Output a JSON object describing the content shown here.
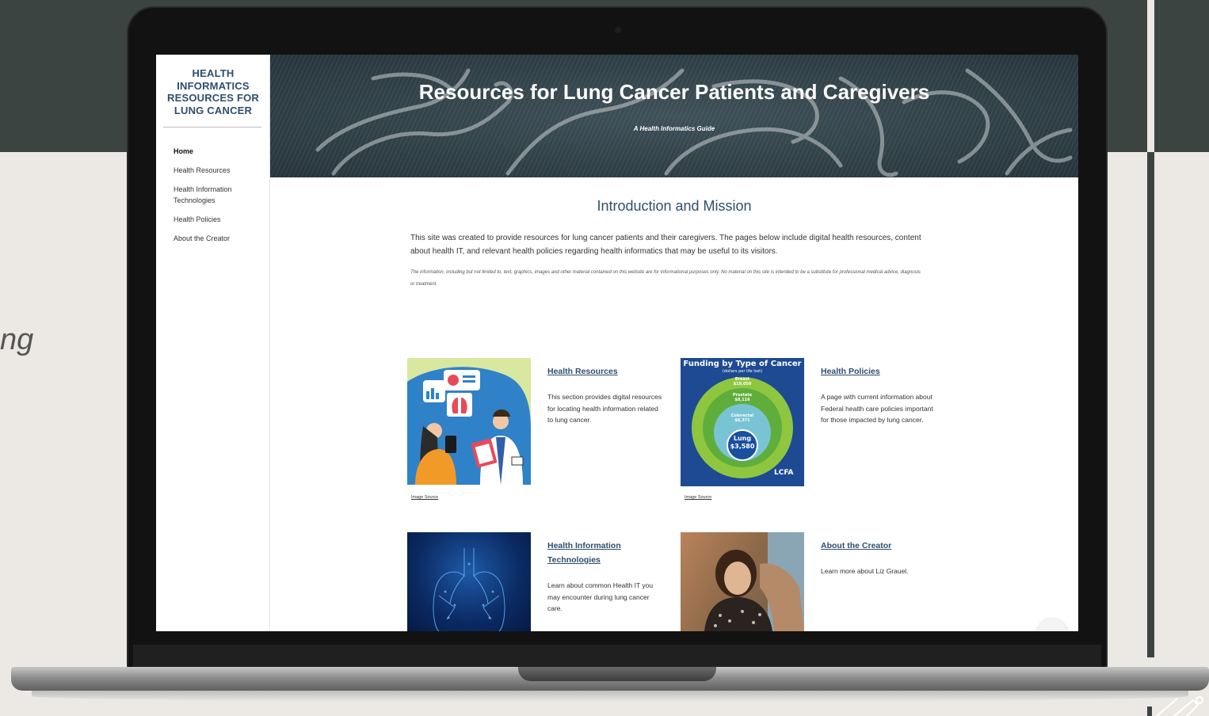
{
  "backdrop": {
    "stray_text": "ng"
  },
  "site": {
    "title": "HEALTH INFORMATICS RESOURCES FOR LUNG CANCER",
    "nav": [
      {
        "label": "Home",
        "active": true
      },
      {
        "label": "Health Resources"
      },
      {
        "label": "Health Information Technologies"
      },
      {
        "label": "Health Policies"
      },
      {
        "label": "About the Creator"
      }
    ]
  },
  "banner": {
    "title": "Resources for Lung Cancer Patients and Caregivers",
    "subtitle": "A Health Informatics Guide"
  },
  "intro": {
    "heading": "Introduction and Mission",
    "body": "This site was created to provide resources for lung cancer patients and their caregivers. The pages below include digital health resources, content about health IT, and relevant health policies regarding health informatics that may be useful to its visitors.",
    "disclaimer": "The information, including but not limited to, text, graphics, images and other material contained on this website are for informational purposes only. No material on this site is intended to be a substitute for professional medical advice, diagnosis or treatment."
  },
  "cards": [
    {
      "title": "Health Resources",
      "description": "This section provides digital resources for locating health information related to lung cancer.",
      "image_source": "Image Source"
    },
    {
      "title": "Health Policies",
      "description": "A page with current information about Federal health care policies important for those impacted by lung cancer.",
      "image_source": "Image Source"
    },
    {
      "title": "Health Information Technologies",
      "description": "Learn about common Health IT you may encounter during lung cancer care."
    },
    {
      "title": "About the Creator",
      "description": "Learn more about Liz Grauel."
    }
  ],
  "funding_image": {
    "title": "Funding by Type of Cancer",
    "subtitle": "(dollars per life lost)",
    "rings": [
      {
        "label": "Breast",
        "value": "$19,050"
      },
      {
        "label": "Prostate",
        "value": "$8,116"
      },
      {
        "label": "Colorectal",
        "value": "$6,371"
      },
      {
        "label": "Lung",
        "value": "$3,580"
      }
    ],
    "logo": "LCFA"
  },
  "colors": {
    "heading": "#2e4f6e",
    "banner": "#33444b",
    "backdrop_dark": "#3c4442",
    "backdrop_light": "#ece9e5"
  }
}
